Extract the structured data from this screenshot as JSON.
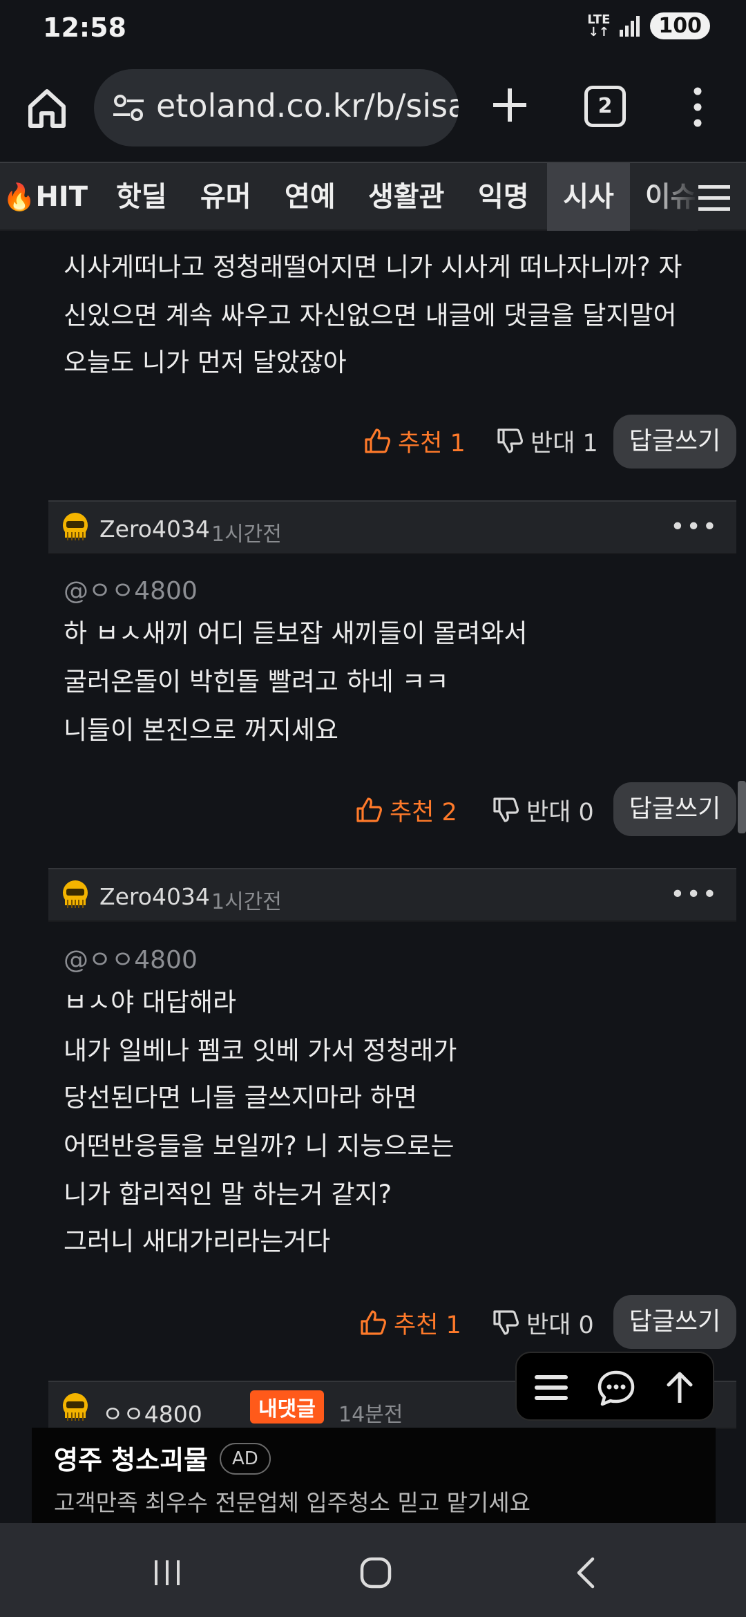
{
  "status_bar": {
    "time": "12:58",
    "network": "LTE",
    "battery": "100"
  },
  "browser": {
    "url": "etoland.co.kr/b/sisa",
    "tab_count": "2"
  },
  "category_nav": {
    "items": [
      "HIT",
      "핫딜",
      "유머",
      "연예",
      "생활관",
      "익명",
      "시사",
      "이슈"
    ],
    "active": "시사"
  },
  "comments": [
    {
      "lines": [
        "시사게떠나고  정청래떨어지면 니가 시사게 떠나자니까?  자",
        "신있으면 계속 싸우고 자신없으면 내글에 댓글을 달지말어",
        "오늘도 니가 먼저 달았잖아"
      ],
      "upvote_label": "추천 1",
      "downvote_label": "반대 1",
      "reply_label": "답글쓰기"
    },
    {
      "author": "Zero4034",
      "time": "1시간전",
      "more": "•••",
      "mention": "@ㅇㅇ4800",
      "lines": [
        "하 ㅂㅅ새끼 어디 듣보잡 새끼들이 몰려와서",
        "굴러온돌이 박힌돌 빨려고 하네 ㅋㅋ",
        "니들이 본진으로 꺼지세요"
      ],
      "upvote_label": "추천 2",
      "downvote_label": "반대 0",
      "reply_label": "답글쓰기"
    },
    {
      "author": "Zero4034",
      "time": "1시간전",
      "more": "•••",
      "mention": "@ㅇㅇ4800",
      "lines": [
        "ㅂㅅ야 대답해라",
        "내가 일베나 펨코 잇베 가서 정청래가",
        "당선된다면 니들 글쓰지마라 하면",
        "어떤반응들을 보일까? 니 지능으로는",
        "니가 합리적인 말 하는거 같지?",
        "그러니 새대가리라는거다"
      ],
      "upvote_label": "추천 1",
      "downvote_label": "반대 0",
      "reply_label": "답글쓰기"
    },
    {
      "author": "ㅇㅇ4800",
      "badge": "내댓글",
      "time": "14분전"
    }
  ],
  "ad": {
    "title": "영주 청소괴물",
    "tag": "AD",
    "description": "고객만족 최우수 전문업체 입주청소 믿고 맡기세요"
  },
  "colors": {
    "accent": "#ff7a2a",
    "badge": "#ff5a1a",
    "background": "#121418"
  }
}
